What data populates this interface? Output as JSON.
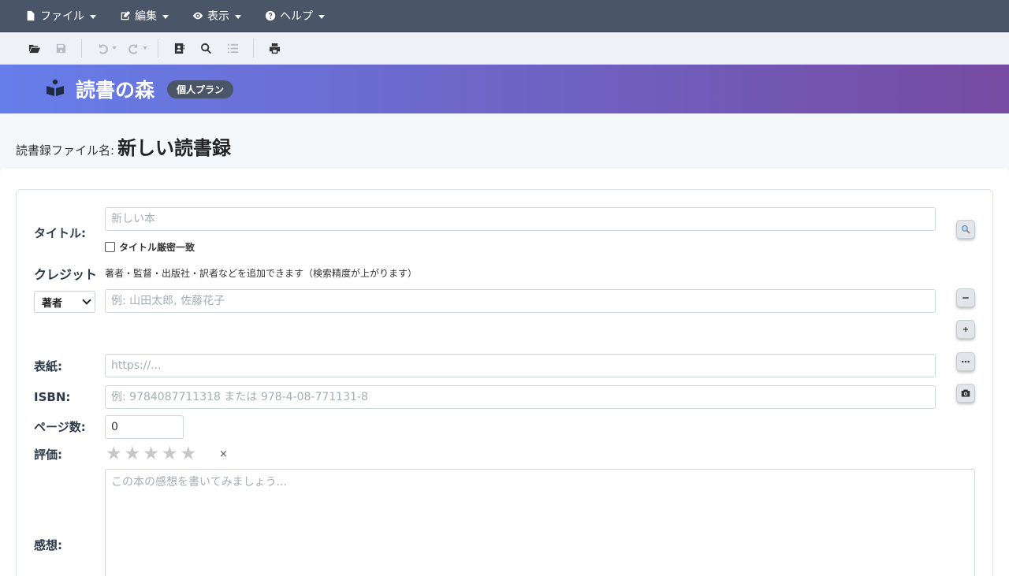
{
  "menubar": {
    "file": "ファイル",
    "edit": "編集",
    "view": "表示",
    "help": "ヘルプ"
  },
  "toolbar": {
    "icons": [
      "folder-open-icon",
      "save-icon",
      "undo-icon",
      "redo-icon",
      "address-book-icon",
      "search-icon",
      "list-icon",
      "print-icon"
    ]
  },
  "banner": {
    "brand": "読書の森",
    "plan": "個人プラン"
  },
  "file": {
    "label": "読書録ファイル名:",
    "name": "新しい読書録"
  },
  "form": {
    "title_label": "タイトル:",
    "title_placeholder": "新しい本",
    "exact_match_label": "タイトル厳密一致",
    "credit_label": "クレジット",
    "credit_hint": "著者・監督・出版社・訳者などを追加できます（検索精度が上がります）",
    "credit_role": "著者",
    "credit_placeholder": "例: 山田太郎, 佐藤花子",
    "cover_label": "表紙:",
    "cover_placeholder": "https://...",
    "isbn_label": "ISBN:",
    "isbn_placeholder": "例: 9784087711318 または 978-4-08-771131-8",
    "pages_label": "ページ数:",
    "pages_value": "0",
    "rating_label": "評価:",
    "rating_value": 0,
    "rating_max": 5,
    "rating_clear": "×",
    "review_label": "感想:",
    "review_placeholder": "この本の感想を書いてみましょう..."
  }
}
